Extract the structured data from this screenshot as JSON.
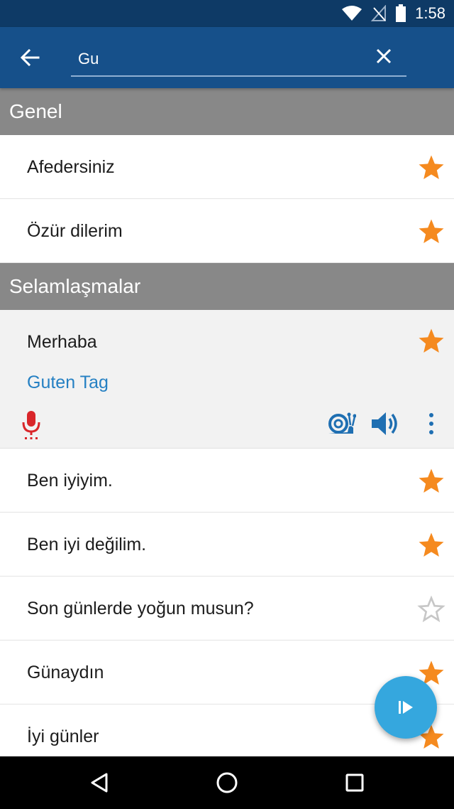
{
  "status_bar": {
    "time": "1:58",
    "icons": [
      "wifi-icon",
      "no-signal-icon",
      "battery-icon"
    ]
  },
  "app_bar": {
    "back_icon": "arrow-back-icon",
    "search_value": "Gu",
    "clear_icon": "close-icon"
  },
  "sections": [
    {
      "title": "Genel",
      "items": [
        {
          "label": "Afedersiniz",
          "favorite": true
        },
        {
          "label": "Özür dilerim",
          "favorite": true
        }
      ]
    },
    {
      "title": "Selamlaşmalar",
      "expanded_item": {
        "label": "Merhaba",
        "translation": "Guten Tag",
        "favorite": true
      },
      "items": [
        {
          "label": "Ben iyiyim.",
          "favorite": true
        },
        {
          "label": "Ben iyi değilim.",
          "favorite": true
        },
        {
          "label": "Son günlerde yoğun musun?",
          "favorite": false
        },
        {
          "label": "Günaydın",
          "favorite": true
        },
        {
          "label": "İyi günler",
          "favorite": true
        }
      ]
    }
  ],
  "colors": {
    "status_bar": "#0e3a66",
    "app_bar": "#16508a",
    "section_header": "#888888",
    "star_filled": "#f58a1f",
    "star_empty": "#c7c7c7",
    "translation": "#2580c3",
    "mic": "#d9262a",
    "audio_icons": "#1f6fb2",
    "fab": "#35a7de"
  },
  "fab_icon": "play-slow-icon",
  "nav_bar": [
    "back-triangle-icon",
    "home-circle-icon",
    "recents-square-icon"
  ]
}
